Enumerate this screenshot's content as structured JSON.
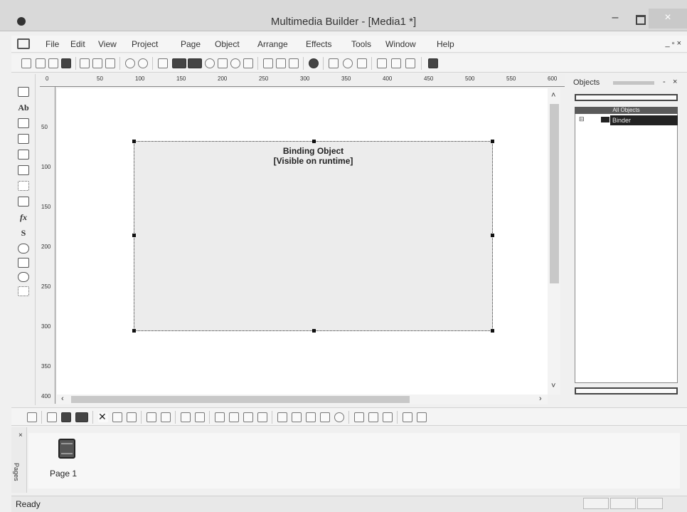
{
  "window": {
    "title": "Multimedia Builder - [Media1 *]",
    "minimize_glyph": "–",
    "close_glyph": "×"
  },
  "menu": {
    "items": [
      "File",
      "Edit",
      "View",
      "Project",
      "Page",
      "Object",
      "Arrange",
      "Effects",
      "Tools",
      "Window",
      "Help"
    ],
    "right_controls": "_ ▫ ×"
  },
  "ruler": {
    "top_ticks": [
      "0",
      "50",
      "100",
      "150",
      "200",
      "250",
      "300",
      "350",
      "400",
      "450",
      "500",
      "550",
      "600"
    ],
    "left_ticks": [
      "50",
      "100",
      "150",
      "200",
      "250",
      "300",
      "350",
      "400"
    ]
  },
  "palette_labels": [
    "Ab",
    "fx",
    "S"
  ],
  "canvas": {
    "object_title": "Binding Object",
    "object_subtitle": "[Visible on runtime]"
  },
  "objects_panel": {
    "title": "Objects",
    "close_glyph": "×",
    "tree_root": "All Objects",
    "tree_node": "Binder"
  },
  "pages_pane": {
    "side_label": "Pages",
    "close_glyph": "×",
    "page_name": "Page 1"
  },
  "status": {
    "text": "Ready"
  }
}
